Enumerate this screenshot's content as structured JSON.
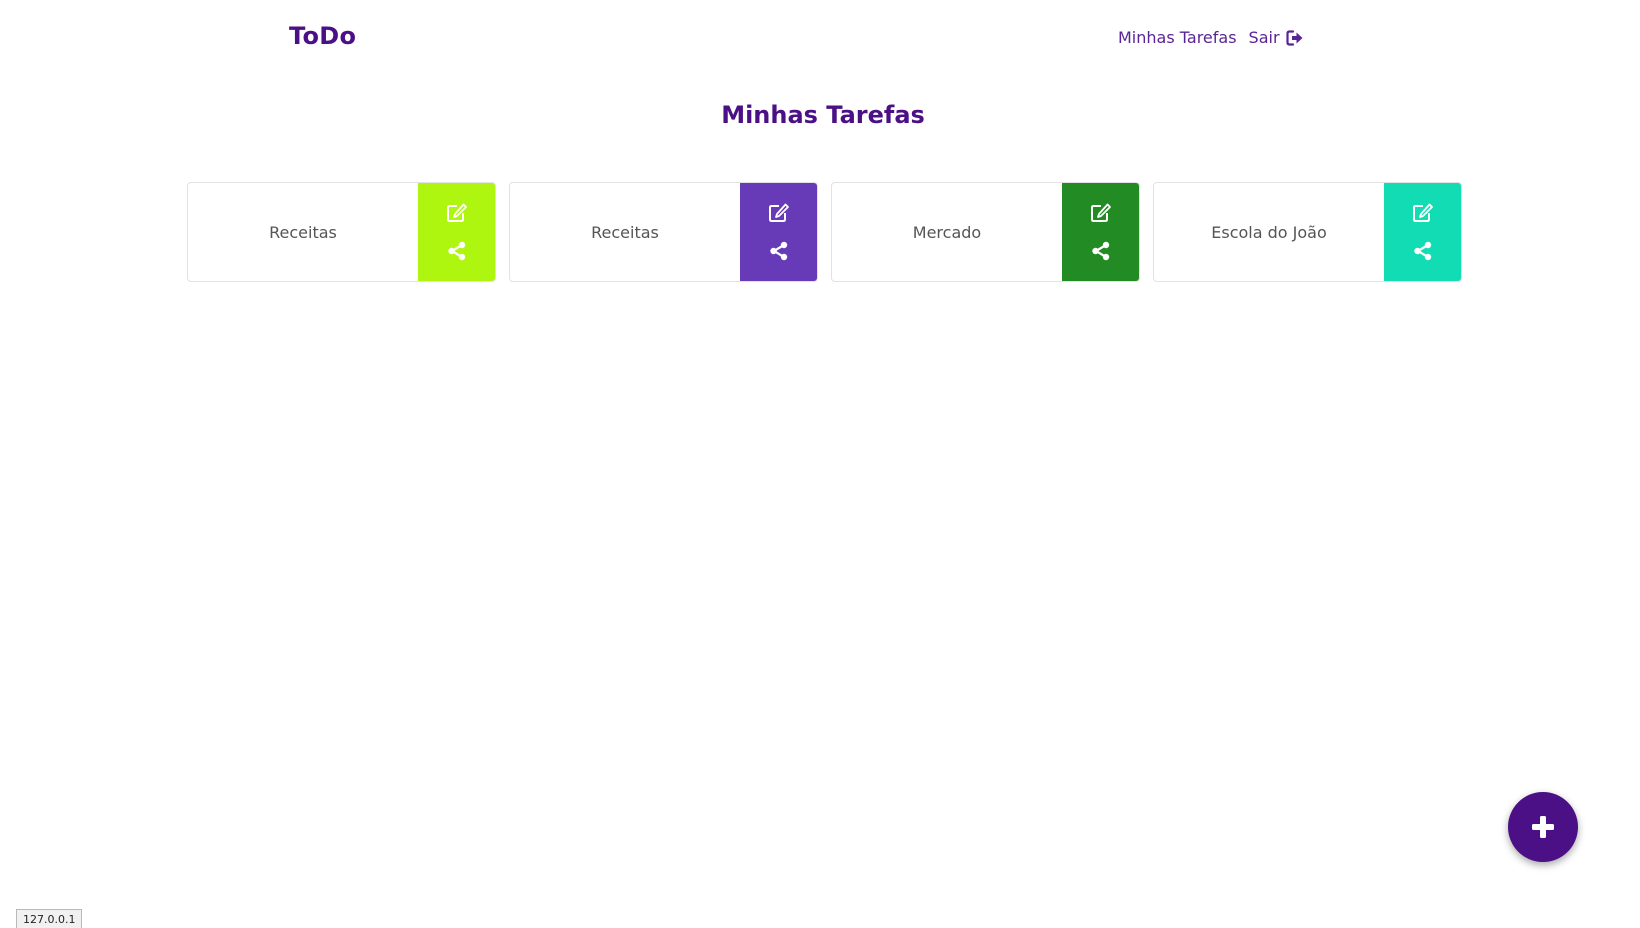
{
  "navbar": {
    "brand": "ToDo",
    "links": [
      {
        "label": "Minhas Tarefas"
      },
      {
        "label": "Sair",
        "icon": "logout-icon"
      }
    ]
  },
  "page": {
    "title": "Minhas Tarefas"
  },
  "lists": [
    {
      "label": "Receitas",
      "color": "#aef50f",
      "actions": [
        "edit-icon",
        "share-icon"
      ]
    },
    {
      "label": "Receitas",
      "color": "#673ab7",
      "actions": [
        "edit-icon",
        "share-icon"
      ]
    },
    {
      "label": "Mercado",
      "color": "#238b23",
      "actions": [
        "edit-icon",
        "share-icon"
      ]
    },
    {
      "label": "Escola do João",
      "color": "#12dcb4",
      "actions": [
        "edit-icon",
        "share-icon"
      ]
    }
  ],
  "fab": {
    "icon": "plus-icon",
    "color": "#4b0f86"
  },
  "status_bar": {
    "text": "127.0.0.1"
  }
}
